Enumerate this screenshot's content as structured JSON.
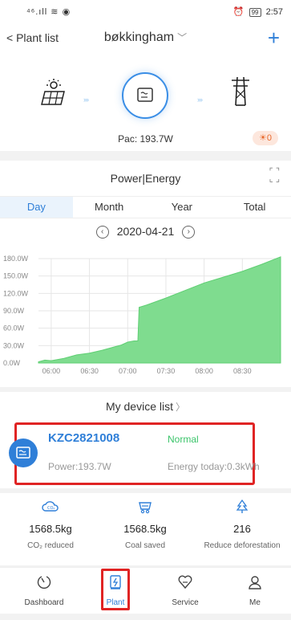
{
  "status_bar": {
    "signal": "⁴⁶.ıll ≋ ◉",
    "alarm_glyph": "⏰",
    "battery": "99",
    "time": "2:57"
  },
  "header": {
    "back_label": "Plant list",
    "plant_name": "bøkkingham"
  },
  "flow": {
    "pac": "Pac: 193.7W",
    "alarm_count": "0"
  },
  "power": {
    "title": "Power|Energy",
    "tabs": [
      {
        "label": "Day",
        "active": true
      },
      {
        "label": "Month"
      },
      {
        "label": "Year"
      },
      {
        "label": "Total"
      }
    ],
    "date": "2020-04-21"
  },
  "chart_data": {
    "type": "area",
    "title": "",
    "xlabel": "",
    "ylabel": "",
    "y_ticks": [
      "0.0W",
      "30.0W",
      "60.0W",
      "90.0W",
      "120.0W",
      "150.0W",
      "180.0W"
    ],
    "x_ticks": [
      "06:00",
      "06:30",
      "07:00",
      "07:30",
      "08:00",
      "08:30"
    ],
    "ylim": [
      0,
      180
    ],
    "xlim": [
      "05:50",
      "09:00"
    ],
    "grid": true,
    "color": "#7fdc8f",
    "series": [
      {
        "x": [
          "05:50",
          "05:55",
          "06:00",
          "06:10",
          "06:20",
          "06:30",
          "06:40",
          "06:50",
          "06:55",
          "07:00",
          "07:05",
          "07:08",
          "07:09",
          "07:15",
          "07:30",
          "07:45",
          "08:00",
          "08:15",
          "08:30",
          "08:45",
          "09:00"
        ],
        "y": [
          2,
          5,
          4,
          8,
          14,
          17,
          22,
          28,
          31,
          36,
          38,
          38,
          96,
          100,
          112,
          125,
          138,
          148,
          158,
          170,
          183
        ]
      }
    ]
  },
  "devices": {
    "title": "My device list",
    "items": [
      {
        "name": "KZC2821008",
        "status": "Normal",
        "power": "Power:193.7W",
        "energy": "Energy today:0.3kWh"
      }
    ]
  },
  "stats": [
    {
      "value": "1568.5kg",
      "label": "CO₂ reduced",
      "icon": "co2-cloud-icon"
    },
    {
      "value": "1568.5kg",
      "label": "Coal saved",
      "icon": "coal-cart-icon"
    },
    {
      "value": "216",
      "label": "Reduce deforestation",
      "icon": "tree-icon"
    }
  ],
  "tabbar": [
    {
      "label": "Dashboard",
      "icon": "dashboard-icon"
    },
    {
      "label": "Plant",
      "icon": "plant-icon",
      "active": true
    },
    {
      "label": "Service",
      "icon": "service-icon"
    },
    {
      "label": "Me",
      "icon": "me-icon"
    }
  ],
  "colors": {
    "accent": "#2f7fd8",
    "chart_fill": "#7fdc8f",
    "normal": "#3ac46a",
    "highlight": "#e02424"
  }
}
